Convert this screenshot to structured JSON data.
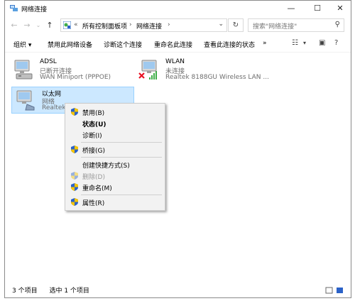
{
  "window": {
    "title": "网络连接",
    "icon": "network-connections-icon",
    "controls": [
      "minimize-icon",
      "maximize-icon",
      "close-icon"
    ]
  },
  "addressbar": {
    "crumb_prefix": "«",
    "crumbs": [
      "所有控制面板项",
      "网络连接"
    ],
    "search_placeholder": "搜索\"网络连接\""
  },
  "toolbar": {
    "items": [
      "组织 ▾",
      "禁用此网络设备",
      "诊断这个连接",
      "重命名此连接",
      "查看此连接的状态",
      "»"
    ]
  },
  "connections": [
    {
      "name": "ADSL",
      "status": "已断开连接",
      "adapter": "WAN Miniport (PPPOE)",
      "icon": "dialup-connection-icon",
      "selected": false
    },
    {
      "name": "WLAN",
      "status": "未连接",
      "adapter": "Realtek 8188GU Wireless LAN ...",
      "icon": "wireless-disconnected-icon",
      "selected": false
    },
    {
      "name": "以太网",
      "status": "网络",
      "adapter": "Realtek P",
      "icon": "ethernet-connection-icon",
      "selected": true
    }
  ],
  "context_menu": {
    "items": [
      {
        "label": "禁用(B)",
        "shield": true,
        "bold": false,
        "disabled": false
      },
      {
        "label": "状态(U)",
        "shield": false,
        "bold": true,
        "disabled": false
      },
      {
        "label": "诊断(I)",
        "shield": false,
        "bold": false,
        "disabled": false
      },
      {
        "label": "桥接(G)",
        "shield": true,
        "bold": false,
        "disabled": false
      },
      {
        "label": "创建快捷方式(S)",
        "shield": false,
        "bold": false,
        "disabled": false
      },
      {
        "label": "删除(D)",
        "shield": true,
        "bold": false,
        "disabled": true
      },
      {
        "label": "重命名(M)",
        "shield": true,
        "bold": false,
        "disabled": false
      },
      {
        "label": "属性(R)",
        "shield": true,
        "bold": false,
        "disabled": false
      }
    ]
  },
  "statusbar": {
    "item_count": "3 个项目",
    "selected_count": "选中 1 个项目"
  },
  "colors": {
    "selection_bg": "#cce8ff",
    "selection_border": "#99d1ff",
    "menu_bg": "#f2f2f2",
    "error_red": "#e81123",
    "shield_blue": "#2b62c8",
    "shield_yellow": "#f5c400"
  }
}
